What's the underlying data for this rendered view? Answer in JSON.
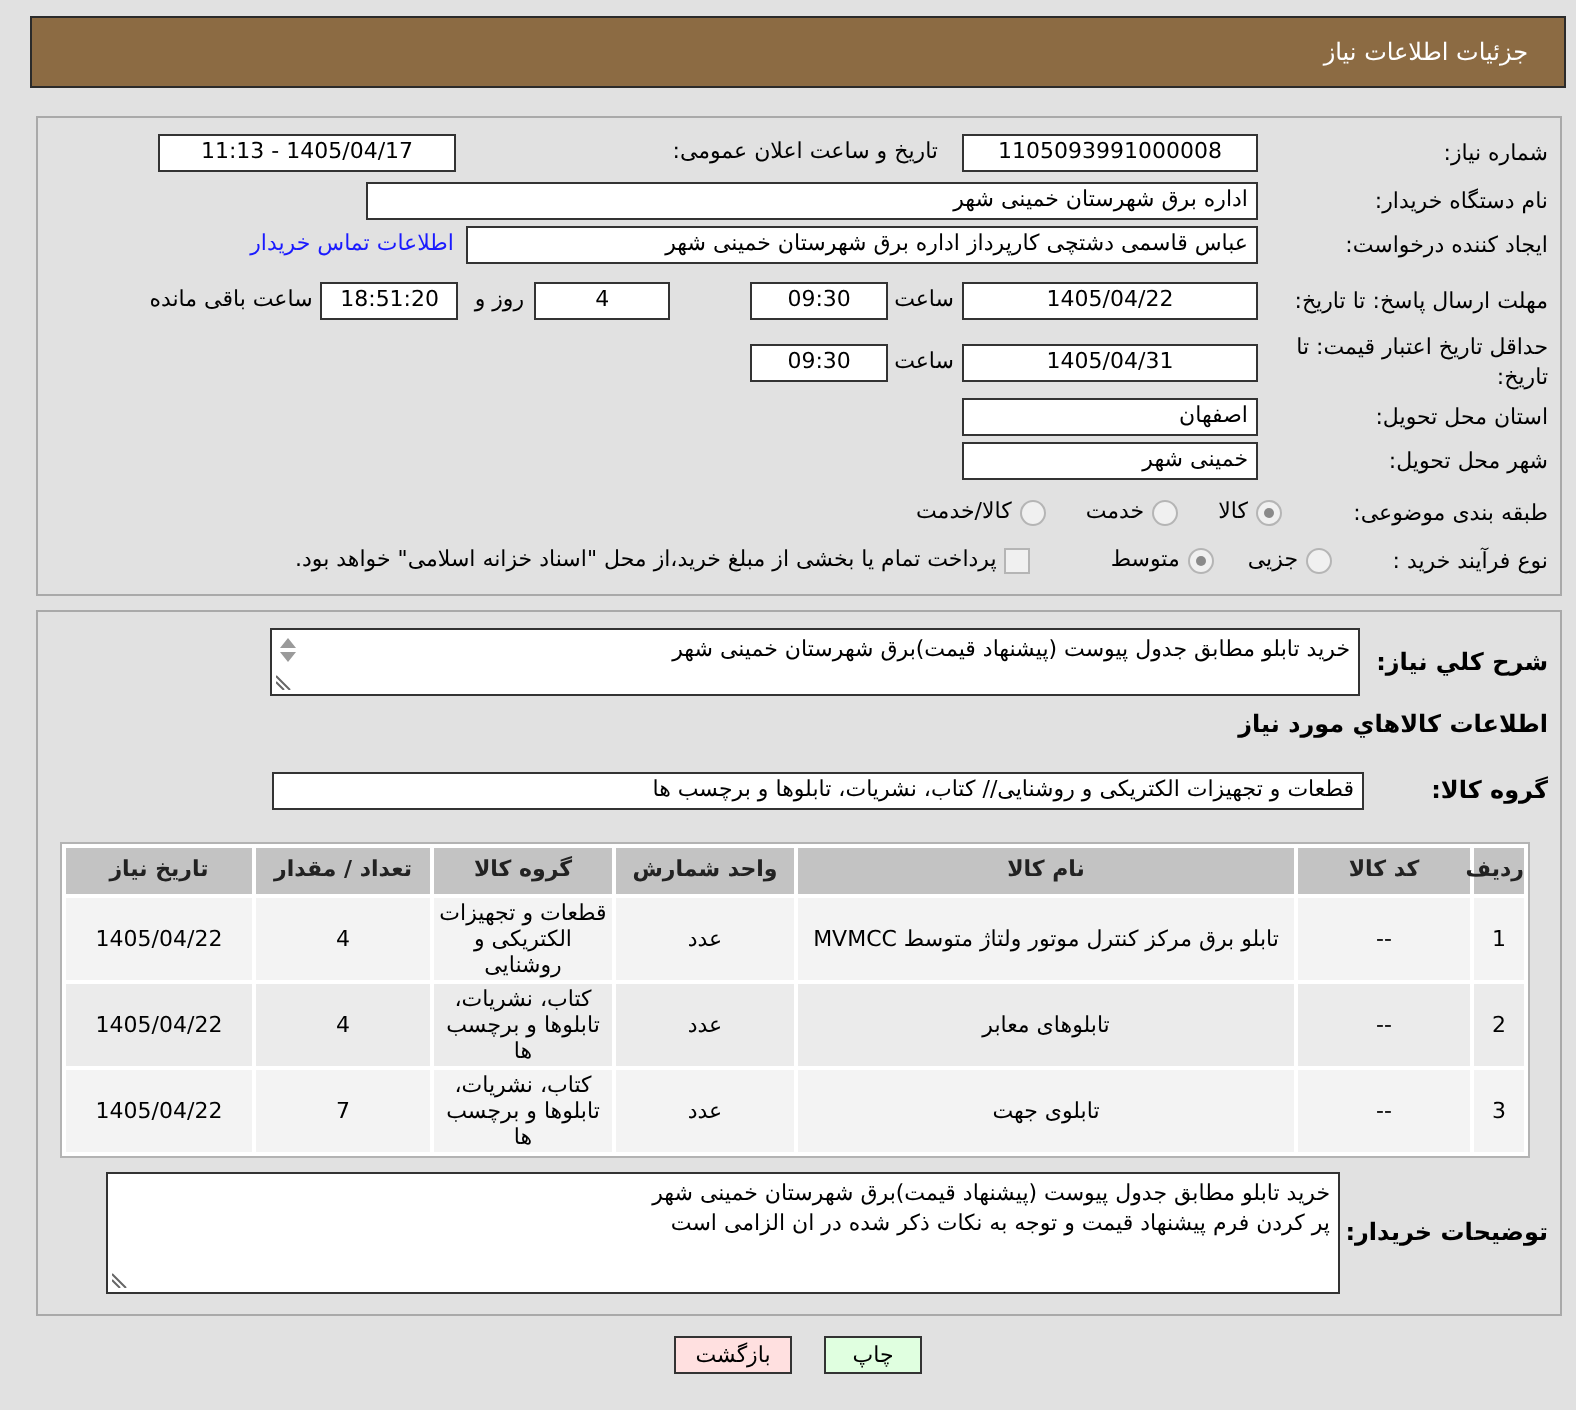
{
  "header": {
    "title": "جزئیات اطلاعات نیاز"
  },
  "details": {
    "need_number": {
      "label": "شماره نیاز:",
      "value": "1105093991000008"
    },
    "announcement": {
      "label": "تاریخ و ساعت اعلان عمومی:",
      "value": "1405/04/17 - 11:13"
    },
    "buyer_org": {
      "label": "نام دستگاه خریدار:",
      "value": "اداره برق شهرستان خمینی شهر"
    },
    "requester": {
      "label": "ایجاد کننده درخواست:",
      "value": "عباس قاسمی دشتچی کارپرداز اداره برق شهرستان خمینی شهر",
      "link": "اطلاعات تماس خریدار"
    },
    "response_deadline": {
      "label": "مهلت ارسال پاسخ: تا تاریخ:",
      "date": "1405/04/22",
      "time_label": "ساعت",
      "time": "09:30",
      "days": "4",
      "days_label": "روز و",
      "remaining": "18:51:20",
      "remaining_label": "ساعت باقی مانده"
    },
    "price_validity": {
      "label": "حداقل تاریخ اعتبار قیمت: تا تاریخ:",
      "date": "1405/04/31",
      "time_label": "ساعت",
      "time": "09:30"
    },
    "province": {
      "label": "استان محل تحویل:",
      "value": "اصفهان"
    },
    "city": {
      "label": "شهر محل تحویل:",
      "value": "خمینی شهر"
    },
    "category": {
      "label": "طبقه بندی موضوعی:",
      "options": [
        {
          "label": "کالا",
          "selected": true,
          "disabled": true
        },
        {
          "label": "خدمت",
          "selected": false,
          "disabled": true
        },
        {
          "label": "کالا/خدمت",
          "selected": false,
          "disabled": true
        }
      ]
    },
    "purchase_process": {
      "label": "نوع فرآیند خرید :",
      "options": [
        {
          "label": "جزیی",
          "selected": false,
          "disabled": true
        },
        {
          "label": "متوسط",
          "selected": true,
          "disabled": true
        }
      ],
      "treasury_payment": {
        "label": "پرداخت تمام یا بخشی از مبلغ خرید،از محل \"اسناد خزانه اسلامی\" خواهد بود.",
        "checked": false,
        "disabled": true
      }
    }
  },
  "needs": {
    "summary": {
      "label": "شرح کلي نياز:",
      "value": "خرید تابلو مطابق جدول پیوست (پیشنهاد قیمت)برق شهرستان خمینی شهر"
    },
    "goods_heading": "اطلاعات کالاهاي مورد نياز",
    "goods_group": {
      "label": "گروه کالا:",
      "value": "قطعات و تجهیزات الکتریکی و روشنایی// کتاب، نشریات، تابلوها و برچسب ها"
    },
    "table": {
      "columns": [
        "ردیف",
        "کد کالا",
        "نام کالا",
        "واحد شمارش",
        "گروه کالا",
        "تعداد / مقدار",
        "تاریخ نیاز"
      ],
      "rows": [
        [
          "1",
          "--",
          "تابلو برق مرکز کنترل موتور ولتاژ متوسط MVMCC",
          "عدد",
          "قطعات و تجهیزات الکتریکی و روشنایی",
          "4",
          "1405/04/22"
        ],
        [
          "2",
          "--",
          "تابلوهای معابر",
          "عدد",
          "کتاب، نشریات، تابلوها و برچسب ها",
          "4",
          "1405/04/22"
        ],
        [
          "3",
          "--",
          "تابلوی جهت",
          "عدد",
          "کتاب، نشریات، تابلوها و برچسب ها",
          "7",
          "1405/04/22"
        ]
      ]
    },
    "buyer_notes": {
      "label": "توضیحات خریدار:",
      "value": "خرید تابلو مطابق جدول پیوست (پیشنهاد قیمت)برق شهرستان خمینی شهر\nپر کردن فرم پیشنهاد قیمت و توجه به نکات ذکر شده در ان الزامی است"
    }
  },
  "buttons": [
    {
      "label": "چاپ",
      "kind": "print"
    },
    {
      "label": "بازگشت",
      "kind": "back"
    }
  ]
}
